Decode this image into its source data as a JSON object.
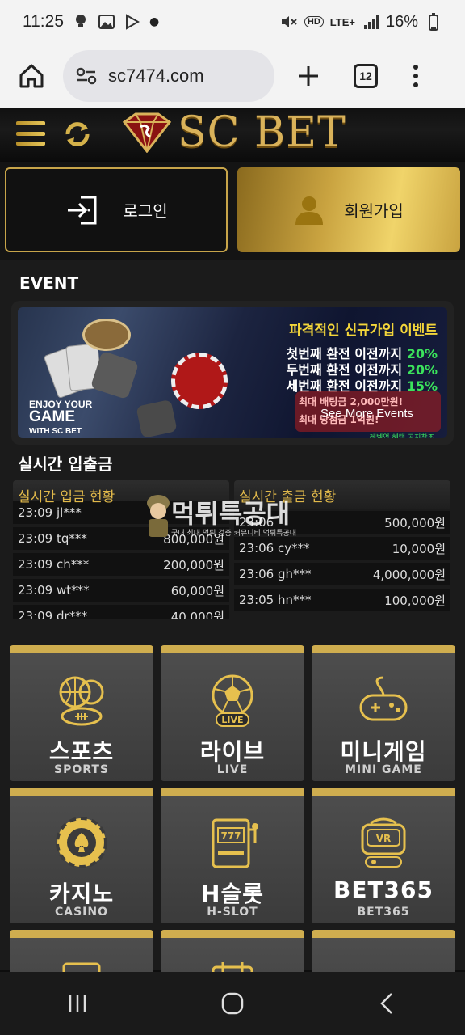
{
  "status_bar": {
    "time": "11:25",
    "battery": "16%",
    "network": "LTE+",
    "hd_badge": "HD"
  },
  "browser": {
    "url": "sc7474.com",
    "tab_count": "12"
  },
  "site": {
    "logo_text": "SC BET"
  },
  "auth": {
    "login_label": "로그인",
    "signup_label": "회원가입"
  },
  "event": {
    "section_title": "EVENT",
    "banner": {
      "headline": "파격적인 신규가입 이벤트",
      "lines": [
        {
          "text": "첫번째 환전 이전까지",
          "pct": "20%"
        },
        {
          "text": "두번째 환전 이전까지",
          "pct": "20%"
        },
        {
          "text": "세번째 환전 이전까지",
          "pct": "15%"
        }
      ],
      "enjoy_1": "ENJOY YOUR",
      "enjoy_2": "GAME",
      "enjoy_3": "WITH SC BET",
      "red_box_1": "최대 배팅금 2,000만원!",
      "red_box_2": "최대 당첨금 1억원!",
      "see_more": "See More Events",
      "footer": "레벨업 혜택 공지참조"
    }
  },
  "realtime": {
    "section_title": "실시간 입출금",
    "deposit": {
      "header": "실시간 입금 현황",
      "rows": [
        {
          "time": "23:09",
          "user": "jl***",
          "amount": ""
        },
        {
          "time": "23:09",
          "user": "tq***",
          "amount": "800,000원"
        },
        {
          "time": "23:09",
          "user": "ch***",
          "amount": "200,000원"
        },
        {
          "time": "23:09",
          "user": "wt***",
          "amount": "60,000원"
        },
        {
          "time": "23:09",
          "user": "dr***",
          "amount": "40,000원"
        }
      ]
    },
    "withdraw": {
      "header": "실시간 출금 현황",
      "rows": [
        {
          "time": "23:06",
          "user": "",
          "amount": "500,000원"
        },
        {
          "time": "23:06",
          "user": "cy***",
          "amount": "10,000원"
        },
        {
          "time": "23:06",
          "user": "gh***",
          "amount": "4,000,000원"
        },
        {
          "time": "23:05",
          "user": "hn***",
          "amount": "100,000원"
        }
      ]
    },
    "watermark_title": "먹튀특공대",
    "watermark_sub": "국내 최대 먹튀 검증 커뮤니티 먹튀특공대"
  },
  "games": [
    {
      "title": "스포츠",
      "sub": "SPORTS",
      "icon": "sports-balls-icon"
    },
    {
      "title": "라이브",
      "sub": "LIVE",
      "icon": "live-soccer-icon"
    },
    {
      "title": "미니게임",
      "sub": "MINI GAME",
      "icon": "gamepad-icon"
    },
    {
      "title": "카지노",
      "sub": "CASINO",
      "icon": "casino-chip-icon"
    },
    {
      "title": "H슬롯",
      "sub": "H-SLOT",
      "icon": "slot-machine-icon"
    },
    {
      "title": "BET365",
      "sub": "BET365",
      "icon": "vr-headset-icon"
    }
  ],
  "colors": {
    "gold": "#cfad4f",
    "gold_light": "#f0d46a",
    "bg_dark": "#0d0d0d",
    "green_pct": "#3be35c"
  }
}
